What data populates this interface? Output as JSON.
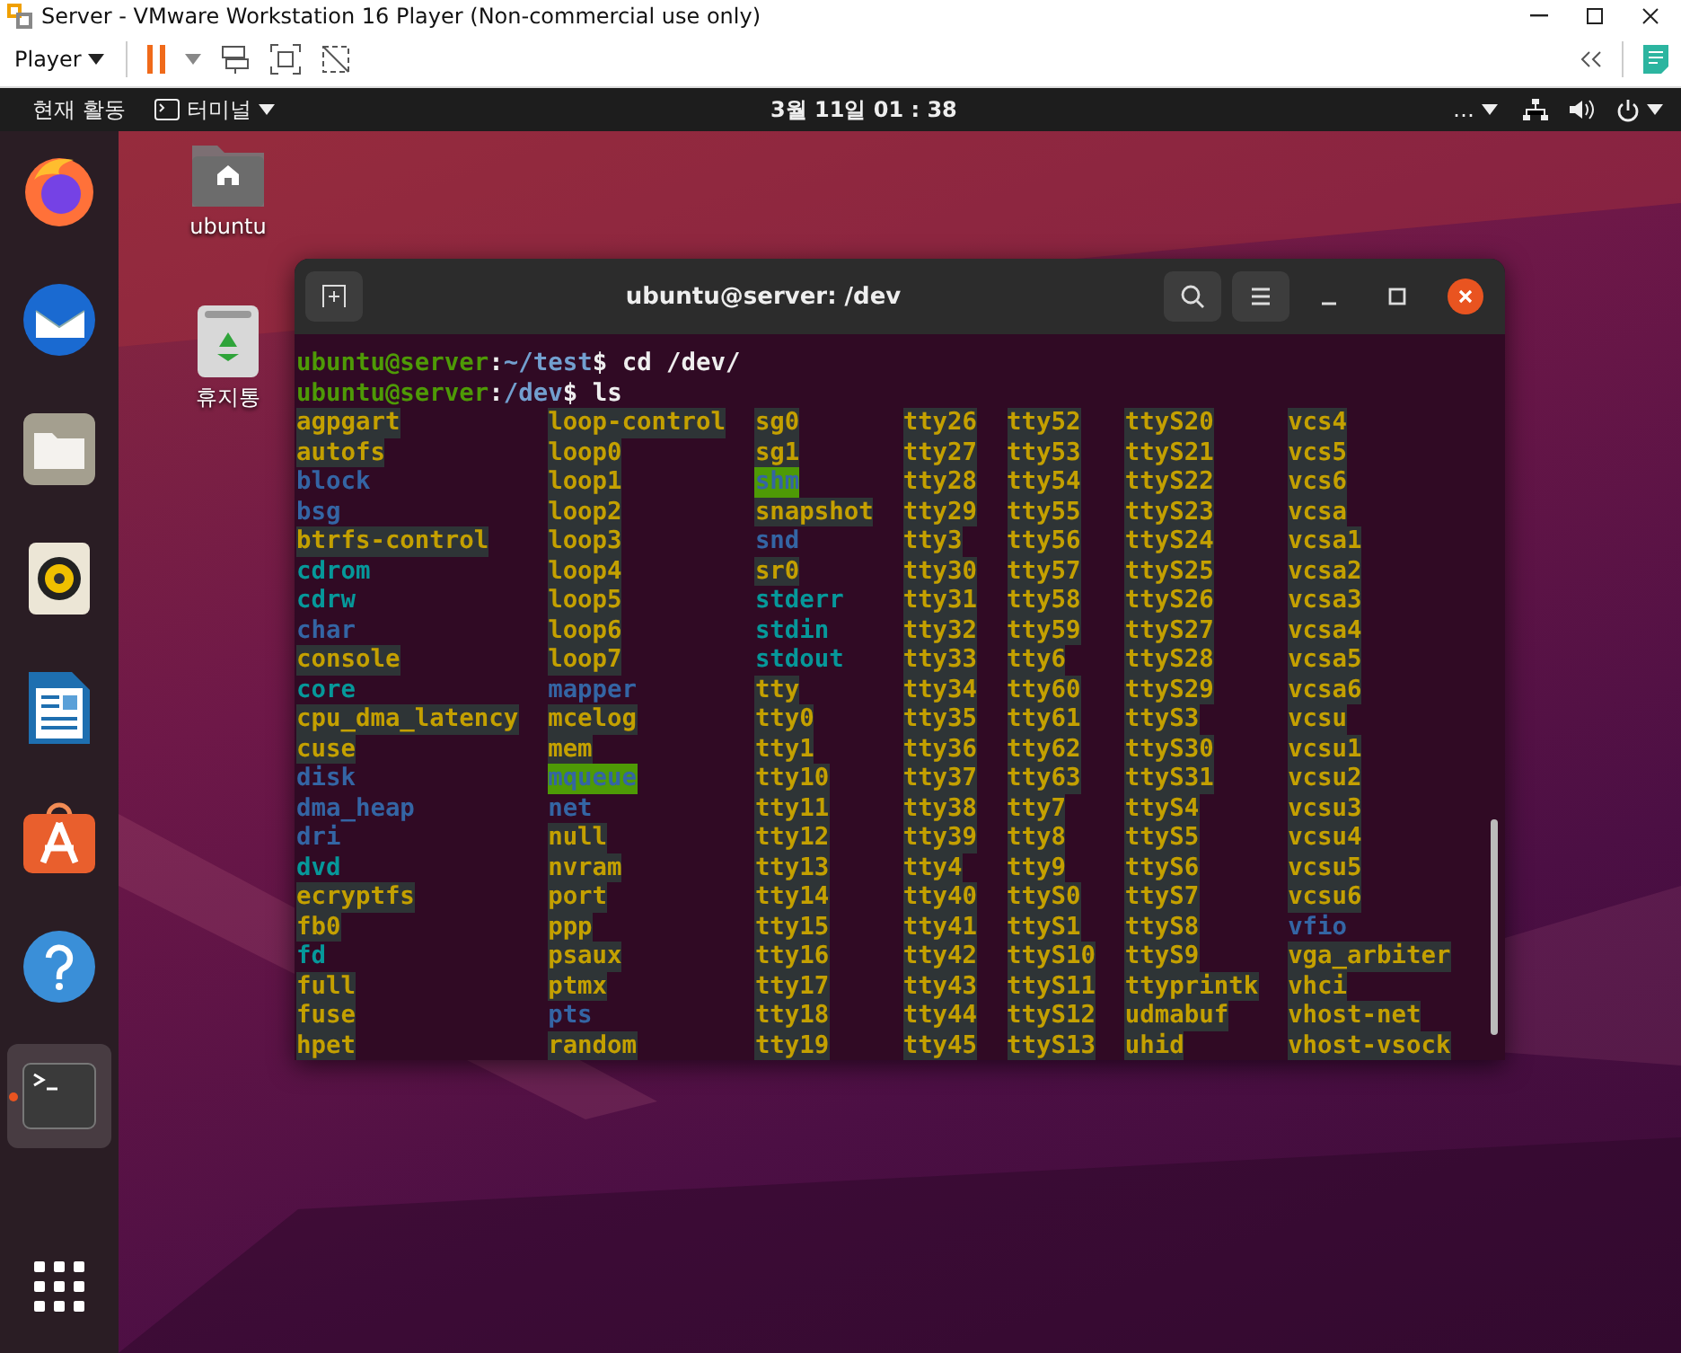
{
  "vmware": {
    "title": "Server - VMware Workstation 16 Player (Non-commercial use only)",
    "player_menu": "Player"
  },
  "topbar": {
    "activities": "현재 활동",
    "app_menu": "터미널",
    "clock": "3월 11일  01 : 38",
    "overflow": "…"
  },
  "dock": [
    {
      "kind": "firefox",
      "running": false
    },
    {
      "kind": "mail",
      "running": false
    },
    {
      "kind": "files",
      "running": false
    },
    {
      "kind": "speaker",
      "running": false
    },
    {
      "kind": "writer",
      "running": false
    },
    {
      "kind": "store",
      "running": false
    },
    {
      "kind": "help",
      "running": false
    },
    {
      "kind": "terminal",
      "running": true
    }
  ],
  "desktop_icons": [
    {
      "kind": "home",
      "label": "ubuntu"
    },
    {
      "kind": "trash",
      "label": "휴지통"
    }
  ],
  "terminal": {
    "title": "ubuntu@server: /dev",
    "prompts": [
      {
        "user": "ubuntu@server",
        "sep": ":",
        "path": "~/test",
        "command": "$ cd /dev/"
      },
      {
        "user": "ubuntu@server",
        "sep": ":",
        "path": "/dev",
        "command": "$ ls"
      }
    ],
    "columns": [
      [
        {
          "name": "agpgart",
          "kind": "device"
        },
        {
          "name": "autofs",
          "kind": "device"
        },
        {
          "name": "block",
          "kind": "dir"
        },
        {
          "name": "bsg",
          "kind": "dir"
        },
        {
          "name": "btrfs-control",
          "kind": "device"
        },
        {
          "name": "cdrom",
          "kind": "link"
        },
        {
          "name": "cdrw",
          "kind": "link"
        },
        {
          "name": "char",
          "kind": "dir"
        },
        {
          "name": "console",
          "kind": "device"
        },
        {
          "name": "core",
          "kind": "link"
        },
        {
          "name": "cpu_dma_latency",
          "kind": "device"
        },
        {
          "name": "cuse",
          "kind": "device"
        },
        {
          "name": "disk",
          "kind": "dir"
        },
        {
          "name": "dma_heap",
          "kind": "dir"
        },
        {
          "name": "dri",
          "kind": "dir"
        },
        {
          "name": "dvd",
          "kind": "link"
        },
        {
          "name": "ecryptfs",
          "kind": "device"
        },
        {
          "name": "fb0",
          "kind": "device"
        },
        {
          "name": "fd",
          "kind": "link"
        },
        {
          "name": "full",
          "kind": "device"
        },
        {
          "name": "fuse",
          "kind": "device"
        },
        {
          "name": "hpet",
          "kind": "device"
        }
      ],
      [
        {
          "name": "loop-control",
          "kind": "device"
        },
        {
          "name": "loop0",
          "kind": "device"
        },
        {
          "name": "loop1",
          "kind": "device"
        },
        {
          "name": "loop2",
          "kind": "device"
        },
        {
          "name": "loop3",
          "kind": "device"
        },
        {
          "name": "loop4",
          "kind": "device"
        },
        {
          "name": "loop5",
          "kind": "device"
        },
        {
          "name": "loop6",
          "kind": "device"
        },
        {
          "name": "loop7",
          "kind": "device"
        },
        {
          "name": "mapper",
          "kind": "dir"
        },
        {
          "name": "mcelog",
          "kind": "device"
        },
        {
          "name": "mem",
          "kind": "device"
        },
        {
          "name": "mqueue",
          "kind": "sticky"
        },
        {
          "name": "net",
          "kind": "dir"
        },
        {
          "name": "null",
          "kind": "device"
        },
        {
          "name": "nvram",
          "kind": "device"
        },
        {
          "name": "port",
          "kind": "device"
        },
        {
          "name": "ppp",
          "kind": "device"
        },
        {
          "name": "psaux",
          "kind": "device"
        },
        {
          "name": "ptmx",
          "kind": "device"
        },
        {
          "name": "pts",
          "kind": "dir"
        },
        {
          "name": "random",
          "kind": "device"
        }
      ],
      [
        {
          "name": "sg0",
          "kind": "device"
        },
        {
          "name": "sg1",
          "kind": "device"
        },
        {
          "name": "shm",
          "kind": "sticky"
        },
        {
          "name": "snapshot",
          "kind": "device"
        },
        {
          "name": "snd",
          "kind": "dir"
        },
        {
          "name": "sr0",
          "kind": "device"
        },
        {
          "name": "stderr",
          "kind": "link"
        },
        {
          "name": "stdin",
          "kind": "link"
        },
        {
          "name": "stdout",
          "kind": "link"
        },
        {
          "name": "tty",
          "kind": "device"
        },
        {
          "name": "tty0",
          "kind": "device"
        },
        {
          "name": "tty1",
          "kind": "device"
        },
        {
          "name": "tty10",
          "kind": "device"
        },
        {
          "name": "tty11",
          "kind": "device"
        },
        {
          "name": "tty12",
          "kind": "device"
        },
        {
          "name": "tty13",
          "kind": "device"
        },
        {
          "name": "tty14",
          "kind": "device"
        },
        {
          "name": "tty15",
          "kind": "device"
        },
        {
          "name": "tty16",
          "kind": "device"
        },
        {
          "name": "tty17",
          "kind": "device"
        },
        {
          "name": "tty18",
          "kind": "device"
        },
        {
          "name": "tty19",
          "kind": "device"
        }
      ],
      [
        {
          "name": "tty26",
          "kind": "device"
        },
        {
          "name": "tty27",
          "kind": "device"
        },
        {
          "name": "tty28",
          "kind": "device"
        },
        {
          "name": "tty29",
          "kind": "device"
        },
        {
          "name": "tty3",
          "kind": "device"
        },
        {
          "name": "tty30",
          "kind": "device"
        },
        {
          "name": "tty31",
          "kind": "device"
        },
        {
          "name": "tty32",
          "kind": "device"
        },
        {
          "name": "tty33",
          "kind": "device"
        },
        {
          "name": "tty34",
          "kind": "device"
        },
        {
          "name": "tty35",
          "kind": "device"
        },
        {
          "name": "tty36",
          "kind": "device"
        },
        {
          "name": "tty37",
          "kind": "device"
        },
        {
          "name": "tty38",
          "kind": "device"
        },
        {
          "name": "tty39",
          "kind": "device"
        },
        {
          "name": "tty4",
          "kind": "device"
        },
        {
          "name": "tty40",
          "kind": "device"
        },
        {
          "name": "tty41",
          "kind": "device"
        },
        {
          "name": "tty42",
          "kind": "device"
        },
        {
          "name": "tty43",
          "kind": "device"
        },
        {
          "name": "tty44",
          "kind": "device"
        },
        {
          "name": "tty45",
          "kind": "device"
        }
      ],
      [
        {
          "name": "tty52",
          "kind": "device"
        },
        {
          "name": "tty53",
          "kind": "device"
        },
        {
          "name": "tty54",
          "kind": "device"
        },
        {
          "name": "tty55",
          "kind": "device"
        },
        {
          "name": "tty56",
          "kind": "device"
        },
        {
          "name": "tty57",
          "kind": "device"
        },
        {
          "name": "tty58",
          "kind": "device"
        },
        {
          "name": "tty59",
          "kind": "device"
        },
        {
          "name": "tty6",
          "kind": "device"
        },
        {
          "name": "tty60",
          "kind": "device"
        },
        {
          "name": "tty61",
          "kind": "device"
        },
        {
          "name": "tty62",
          "kind": "device"
        },
        {
          "name": "tty63",
          "kind": "device"
        },
        {
          "name": "tty7",
          "kind": "device"
        },
        {
          "name": "tty8",
          "kind": "device"
        },
        {
          "name": "tty9",
          "kind": "device"
        },
        {
          "name": "ttyS0",
          "kind": "device"
        },
        {
          "name": "ttyS1",
          "kind": "device"
        },
        {
          "name": "ttyS10",
          "kind": "device"
        },
        {
          "name": "ttyS11",
          "kind": "device"
        },
        {
          "name": "ttyS12",
          "kind": "device"
        },
        {
          "name": "ttyS13",
          "kind": "device"
        }
      ],
      [
        {
          "name": "ttyS20",
          "kind": "device"
        },
        {
          "name": "ttyS21",
          "kind": "device"
        },
        {
          "name": "ttyS22",
          "kind": "device"
        },
        {
          "name": "ttyS23",
          "kind": "device"
        },
        {
          "name": "ttyS24",
          "kind": "device"
        },
        {
          "name": "ttyS25",
          "kind": "device"
        },
        {
          "name": "ttyS26",
          "kind": "device"
        },
        {
          "name": "ttyS27",
          "kind": "device"
        },
        {
          "name": "ttyS28",
          "kind": "device"
        },
        {
          "name": "ttyS29",
          "kind": "device"
        },
        {
          "name": "ttyS3",
          "kind": "device"
        },
        {
          "name": "ttyS30",
          "kind": "device"
        },
        {
          "name": "ttyS31",
          "kind": "device"
        },
        {
          "name": "ttyS4",
          "kind": "device"
        },
        {
          "name": "ttyS5",
          "kind": "device"
        },
        {
          "name": "ttyS6",
          "kind": "device"
        },
        {
          "name": "ttyS7",
          "kind": "device"
        },
        {
          "name": "ttyS8",
          "kind": "device"
        },
        {
          "name": "ttyS9",
          "kind": "device"
        },
        {
          "name": "ttyprintk",
          "kind": "device"
        },
        {
          "name": "udmabuf",
          "kind": "device"
        },
        {
          "name": "uhid",
          "kind": "device"
        }
      ],
      [
        {
          "name": "vcs4",
          "kind": "device"
        },
        {
          "name": "vcs5",
          "kind": "device"
        },
        {
          "name": "vcs6",
          "kind": "device"
        },
        {
          "name": "vcsa",
          "kind": "device"
        },
        {
          "name": "vcsa1",
          "kind": "device"
        },
        {
          "name": "vcsa2",
          "kind": "device"
        },
        {
          "name": "vcsa3",
          "kind": "device"
        },
        {
          "name": "vcsa4",
          "kind": "device"
        },
        {
          "name": "vcsa5",
          "kind": "device"
        },
        {
          "name": "vcsa6",
          "kind": "device"
        },
        {
          "name": "vcsu",
          "kind": "device"
        },
        {
          "name": "vcsu1",
          "kind": "device"
        },
        {
          "name": "vcsu2",
          "kind": "device"
        },
        {
          "name": "vcsu3",
          "kind": "device"
        },
        {
          "name": "vcsu4",
          "kind": "device"
        },
        {
          "name": "vcsu5",
          "kind": "device"
        },
        {
          "name": "vcsu6",
          "kind": "device"
        },
        {
          "name": "vfio",
          "kind": "dir"
        },
        {
          "name": "vga_arbiter",
          "kind": "device"
        },
        {
          "name": "vhci",
          "kind": "device"
        },
        {
          "name": "vhost-net",
          "kind": "device"
        },
        {
          "name": "vhost-vsock",
          "kind": "device"
        }
      ]
    ]
  }
}
